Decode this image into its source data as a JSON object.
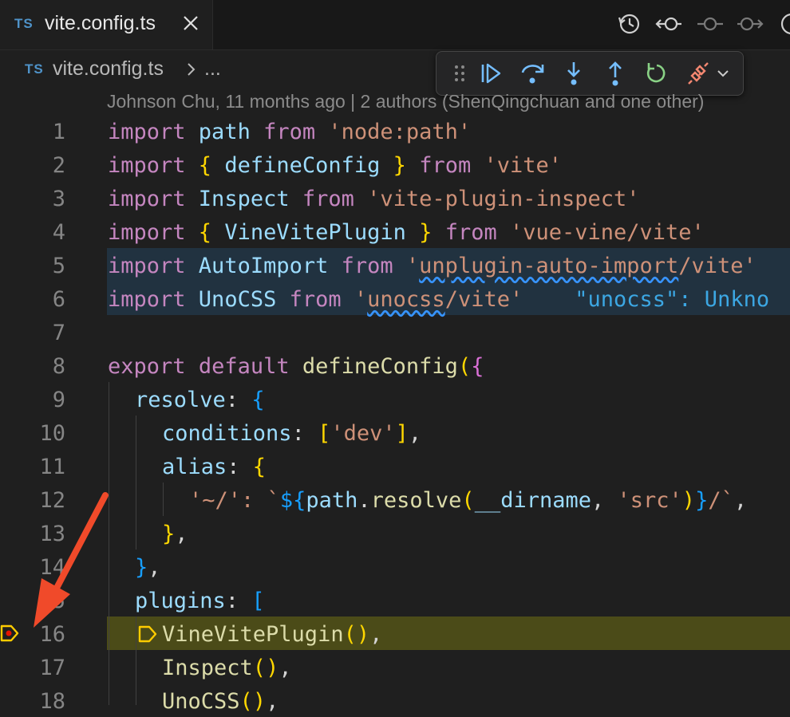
{
  "tab": {
    "lang": "TS",
    "filename": "vite.config.ts"
  },
  "breadcrumb": {
    "lang": "TS",
    "file": "vite.config.ts",
    "more": "..."
  },
  "blame": "Johnson Chu, 11 months ago | 2 authors (ShenQingchuan and one other)",
  "lines": [
    {
      "num": "1"
    },
    {
      "num": "2"
    },
    {
      "num": "3"
    },
    {
      "num": "4"
    },
    {
      "num": "5"
    },
    {
      "num": "6"
    },
    {
      "num": "7"
    },
    {
      "num": "8"
    },
    {
      "num": "9"
    },
    {
      "num": "10"
    },
    {
      "num": "11"
    },
    {
      "num": "12"
    },
    {
      "num": "13"
    },
    {
      "num": "14"
    },
    {
      "num": "15"
    },
    {
      "num": "16"
    },
    {
      "num": "17"
    },
    {
      "num": "18"
    }
  ],
  "code": {
    "l1": [
      "import",
      " path ",
      "from",
      " 'node:path'"
    ],
    "l2": [
      "import",
      " { ",
      "defineConfig",
      " } ",
      "from",
      " 'vite'"
    ],
    "l3": [
      "import",
      " Inspect ",
      "from",
      " 'vite-plugin-inspect'"
    ],
    "l4": [
      "import",
      " { ",
      "VineVitePlugin",
      " } ",
      "from",
      " 'vue-vine/vite'"
    ],
    "l5": [
      "import",
      " AutoImport ",
      "from",
      " '",
      "unplugin-auto-import",
      "/vite'"
    ],
    "l6": [
      "import",
      " UnoCSS ",
      "from",
      " '",
      "unocss",
      "/vite'",
      "    \"unocss\": Unkno"
    ],
    "l8": [
      "export",
      " ",
      "default",
      " ",
      "defineConfig",
      "(",
      "{"
    ],
    "l9": [
      "resolve",
      ": ",
      "{"
    ],
    "l10": [
      "conditions",
      ": ",
      "[",
      "'dev'",
      "]",
      ","
    ],
    "l11": [
      "alias",
      ": ",
      "{"
    ],
    "l12": [
      "'~/'",
      ": `",
      "${",
      "path",
      ".",
      "resolve",
      "(",
      "__dirname",
      ", ",
      "'src'",
      ")",
      "}",
      "/`",
      ","
    ],
    "l13": [
      "}",
      ","
    ],
    "l14": [
      "}",
      ","
    ],
    "l15": [
      "plugins",
      ": ",
      "["
    ],
    "l16": [
      "VineVitePlugin",
      "(",
      ")",
      ","
    ],
    "l17": [
      "Inspect",
      "(",
      ")",
      ","
    ],
    "l18": [
      "UnoCSS",
      "(",
      ")",
      ","
    ]
  },
  "colors": {
    "keyword": "#c586c0",
    "identifier": "#9cdcfe",
    "function": "#dcdcaa",
    "string": "#ce9178",
    "debug_line": "#4b4b18",
    "annotation_arrow": "#f04a2a"
  },
  "debug_toolbar": {
    "buttons": [
      "gripper-icon",
      "continue-icon",
      "step-over-icon",
      "step-into-icon",
      "step-out-icon",
      "restart-icon",
      "disconnect-icon",
      "chevron-down-icon"
    ]
  },
  "editor_actions": [
    "timeline-icon",
    "go-back-icon",
    "commit-icon",
    "go-forward-icon",
    "info-icon"
  ]
}
